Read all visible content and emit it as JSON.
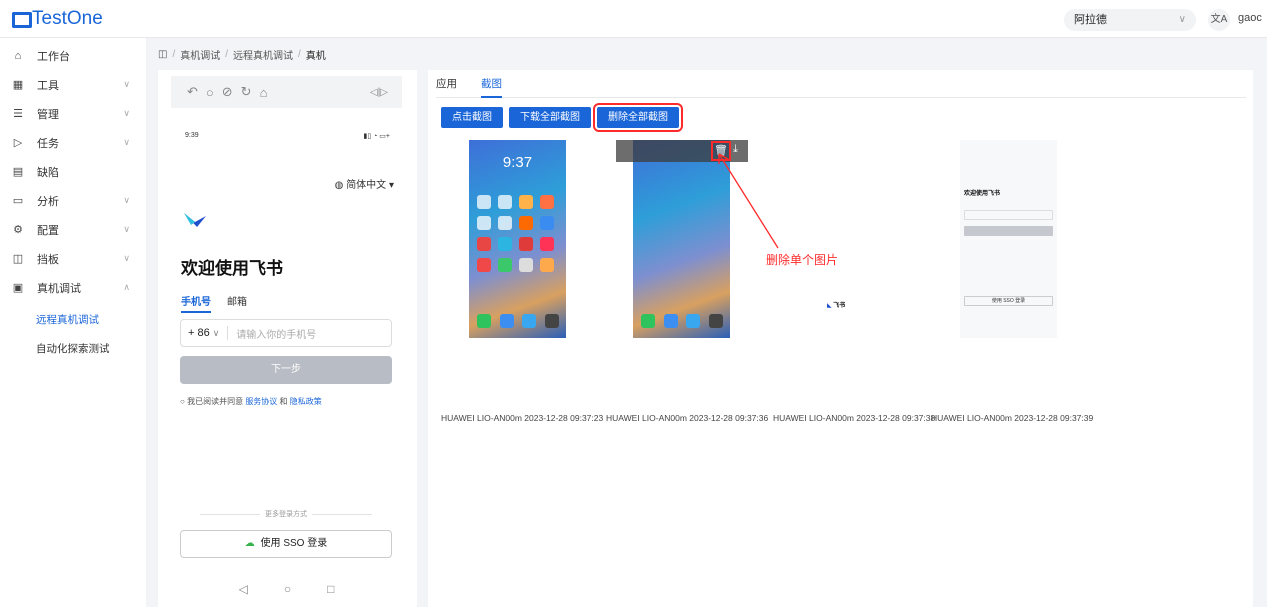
{
  "app": {
    "brand": "TestOne",
    "project": "阿拉德",
    "user": "gaoc"
  },
  "sidebar": {
    "items": [
      {
        "icon": "home-icon",
        "label": "工作台"
      },
      {
        "icon": "grid-icon",
        "label": "工具"
      },
      {
        "icon": "list-icon",
        "label": "管理"
      },
      {
        "icon": "play-icon",
        "label": "任务"
      },
      {
        "icon": "bug-icon",
        "label": "缺陷"
      },
      {
        "icon": "calendar-icon",
        "label": "分析"
      },
      {
        "icon": "gear-icon",
        "label": "配置"
      },
      {
        "icon": "board-icon",
        "label": "挡板"
      },
      {
        "icon": "device-icon",
        "label": "真机调试"
      }
    ],
    "sub_items": [
      "远程真机调试",
      "自动化探索测试"
    ]
  },
  "breadcrumb": [
    "真机调试",
    "远程真机调试",
    "真机"
  ],
  "phone": {
    "status_time": "9:39",
    "language": "简体中文",
    "welcome": "欢迎使用飞书",
    "tab_phone": "手机号",
    "tab_email": "邮箱",
    "country_code": "+ 86",
    "input_placeholder": "请输入你的手机号",
    "next": "下一步",
    "agree_prefix": "我已阅读并同意",
    "service": "服务协议",
    "and": "和",
    "privacy": "隐私政策",
    "more": "更多登录方式",
    "sso": "使用 SSO 登录"
  },
  "main": {
    "tabs": [
      "应用",
      "截图"
    ],
    "buttons": [
      "点击截图",
      "下载全部截图",
      "删除全部截图"
    ],
    "screenshots": [
      {
        "caption": "HUAWEI LIO-AN00m 2023-12-28 09:37:23",
        "clock": "9:37"
      },
      {
        "caption": "HUAWEI LIO-AN00m 2023-12-28 09:37:36"
      },
      {
        "caption": "HUAWEI LIO-AN00m 2023-12-28 09:37:38",
        "app_name": "飞书"
      },
      {
        "caption": "HUAWEI LIO-AN00m 2023-12-28 09:37:39",
        "mini_title": "欢迎使用飞书",
        "mini_sso": "使用 SSO 登录"
      }
    ],
    "annotation": "删除单个图片"
  }
}
